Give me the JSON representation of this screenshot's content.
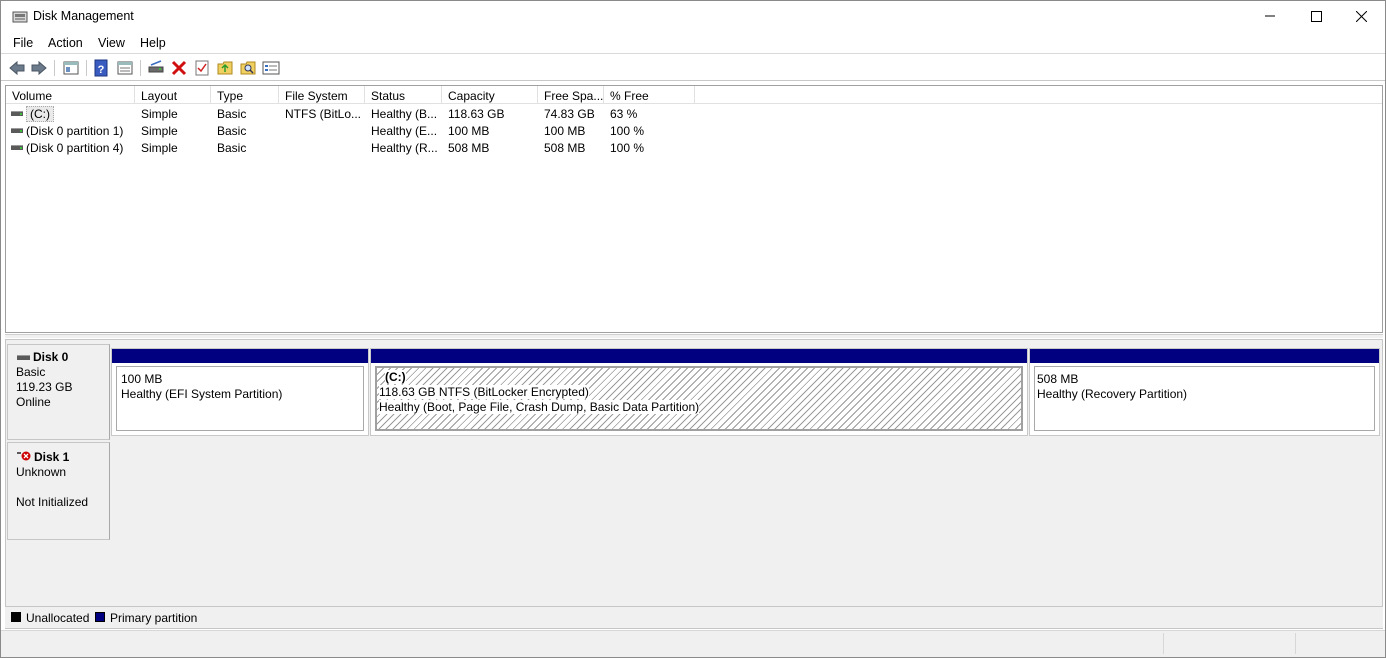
{
  "window": {
    "title": "Disk Management"
  },
  "menu": [
    "File",
    "Action",
    "View",
    "Help"
  ],
  "toolbar": {
    "buttons": [
      "back-icon",
      "forward-icon",
      "show-hide-console-tree-icon",
      "help-icon",
      "properties-icon",
      "connect-drive-icon",
      "delete-icon",
      "check-icon",
      "import-icon",
      "search-icon",
      "settings-list-icon"
    ]
  },
  "volume_list": {
    "columns": [
      "Volume",
      "Layout",
      "Type",
      "File System",
      "Status",
      "Capacity",
      "Free Spa...",
      "% Free"
    ],
    "rows": [
      {
        "volume": "(C:)",
        "layout": "Simple",
        "type": "Basic",
        "fs": "NTFS (BitLo...",
        "status": "Healthy (B...",
        "capacity": "118.63 GB",
        "free": "74.83 GB",
        "pct": "63 %"
      },
      {
        "volume": "(Disk 0 partition 1)",
        "layout": "Simple",
        "type": "Basic",
        "fs": "",
        "status": "Healthy (E...",
        "capacity": "100 MB",
        "free": "100 MB",
        "pct": "100 %"
      },
      {
        "volume": "(Disk 0 partition 4)",
        "layout": "Simple",
        "type": "Basic",
        "fs": "",
        "status": "Healthy (R...",
        "capacity": "508 MB",
        "free": "508 MB",
        "pct": "100 %"
      }
    ]
  },
  "disks": [
    {
      "name": "Disk 0",
      "type": "Basic",
      "size": "119.23 GB",
      "state": "Online",
      "partitions": [
        {
          "label": "",
          "line1": "100 MB",
          "line2": "Healthy (EFI System Partition)"
        },
        {
          "label": "(C:)",
          "line1": "118.63 GB NTFS (BitLocker Encrypted)",
          "line2": "Healthy (Boot, Page File, Crash Dump, Basic Data Partition)"
        },
        {
          "label": "",
          "line1": "508 MB",
          "line2": "Healthy (Recovery Partition)"
        }
      ]
    },
    {
      "name": "Disk 1",
      "type": "Unknown",
      "size": "",
      "state": "Not Initialized",
      "partitions": []
    }
  ],
  "legend": [
    {
      "label": "Unallocated",
      "color": "#000000"
    },
    {
      "label": "Primary partition",
      "color": "#000080"
    }
  ],
  "colors": {
    "partition_header": "#000080",
    "error_icon": "#cc0000"
  }
}
